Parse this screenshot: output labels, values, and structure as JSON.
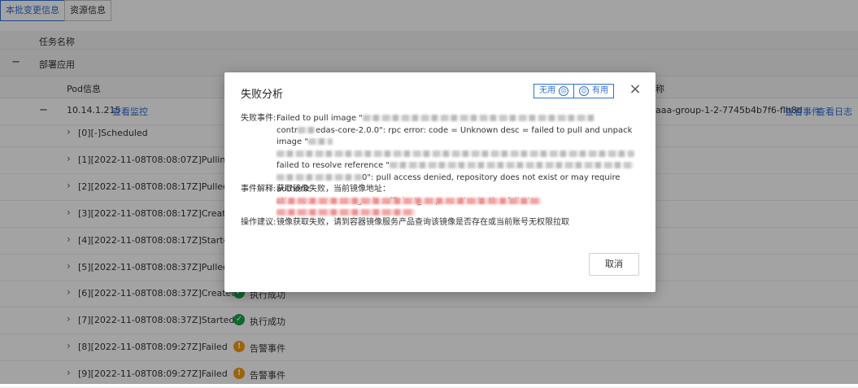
{
  "tabs": [
    "本批变更信息",
    "资源信息"
  ],
  "table": {
    "col_task_name": "任务名称",
    "group_toggle": "−",
    "group_label": "部署应用",
    "col_pod_info": "Pod信息",
    "col_name_partial": "称",
    "pod": {
      "toggle": "−",
      "ip": "10.14.1.215",
      "monitor_link": "查看监控",
      "name": "aaa-group-1-2-7745b4b7f6-flh8d",
      "event_link": "查看事件",
      "log_link": "查看日志"
    },
    "events": [
      {
        "label": "[0][-]Scheduled",
        "status": ""
      },
      {
        "label": "[1][2022-11-08T08:08:07Z]Pulling",
        "status": ""
      },
      {
        "label": "[2][2022-11-08T08:08:17Z]Pulled",
        "status": ""
      },
      {
        "label": "[3][2022-11-08T08:08:17Z]Created",
        "status": ""
      },
      {
        "label": "[4][2022-11-08T08:08:17Z]Started",
        "status": ""
      },
      {
        "label": "[5][2022-11-08T08:08:37Z]Pulled",
        "status": ""
      },
      {
        "label": "[6][2022-11-08T08:08:37Z]Created",
        "status": "执行成功"
      },
      {
        "label": "[7][2022-11-08T08:08:37Z]Started",
        "status": "执行成功"
      },
      {
        "label": "[8][2022-11-08T08:09:27Z]Failed",
        "status": "告警事件"
      },
      {
        "label": "[9][2022-11-08T08:09:27Z]Failed",
        "status": "告警事件"
      }
    ]
  },
  "modal": {
    "title": "失败分析",
    "feedback_no": "无用",
    "feedback_yes": "有用",
    "close_icon": "×",
    "event_key": "失败事件:",
    "event_line1": "Failed to pull image \"",
    "event_line2_a": "contr",
    "event_line2_b": "edas-core-2.0.0\": rpc error: code = Unknown desc = failed to pull and unpack image \"",
    "event_line4": "failed to resolve reference \"",
    "event_line5": "0\": pull access denied, repository does not exist or may require authoriz",
    "event_line6": "ation: server message: insufficient_scope: authorization failed",
    "explain_key": "事件解释:",
    "explain_text": "获取镜像失败，当前镜像地址：",
    "suggest_key": "操作建议:",
    "suggest_text": "镜像获取失败，请到容器镜像服务产品查询该镜像是否存在或当前账号无权限拉取",
    "cancel": "取消"
  }
}
